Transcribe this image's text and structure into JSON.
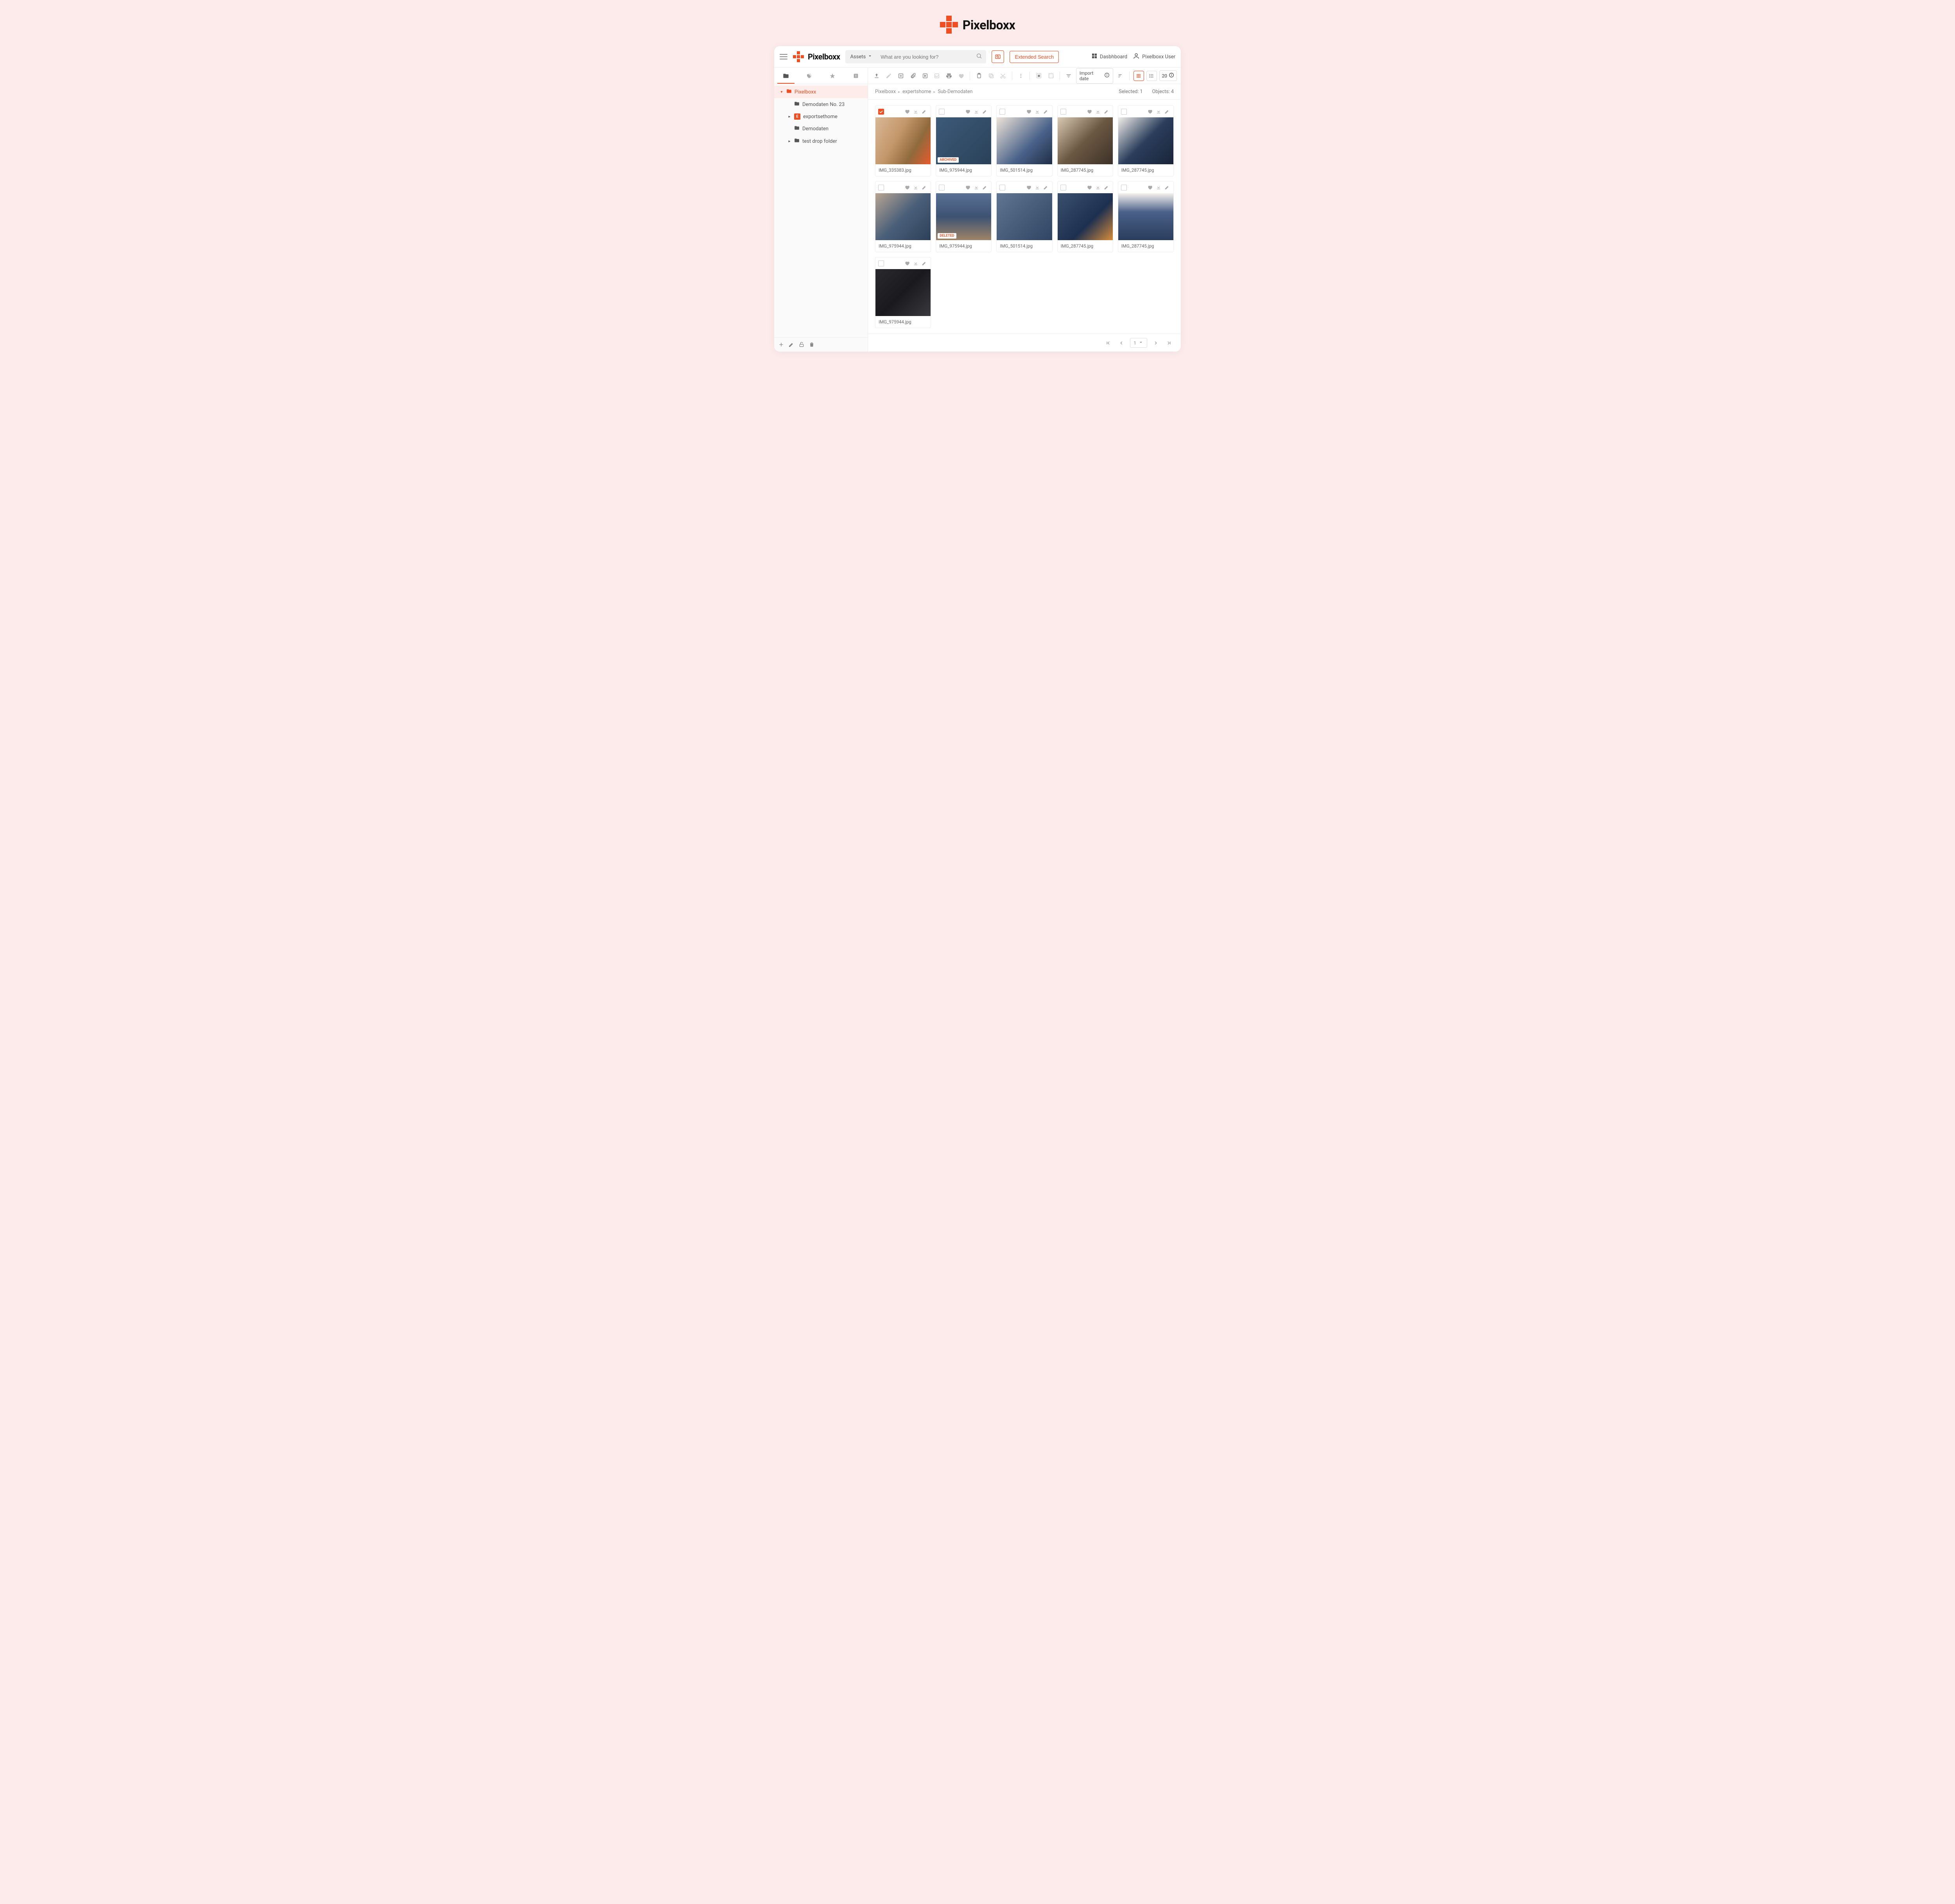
{
  "brand": {
    "name": "Pixelboxx"
  },
  "topbar": {
    "assets_label": "Assets",
    "search_placeholder": "What are you looking for?",
    "extended_search": "Extended Search",
    "dashboard": "Dasbhboard",
    "user": "Pixelboxx User"
  },
  "toolbar": {
    "import_date": "Import date",
    "page_size": "20"
  },
  "sidebar": {
    "items": [
      {
        "label": "Pixelboxx",
        "active": true,
        "expanded": true
      },
      {
        "label": "Demodaten No. 23"
      },
      {
        "label": "exportsethome",
        "caret": true,
        "iconE": true
      },
      {
        "label": "Demodaten"
      },
      {
        "label": "test drop folder",
        "caret": true
      }
    ]
  },
  "breadcrumb": {
    "items": [
      "Pixelboxx",
      "expertshome",
      "Sub-Demodaten"
    ],
    "selected_label": "Selected:",
    "selected_count": "1",
    "objects_label": "Objects:",
    "objects_count": "4"
  },
  "badges": {
    "archived": "ARCHIVED",
    "deleted": "DELETED"
  },
  "assets": [
    {
      "name": "IMG_335383.jpg",
      "checked": true,
      "thumb": "t1"
    },
    {
      "name": "IMG_975944.jpg",
      "badge": "archived",
      "thumb": "t2"
    },
    {
      "name": "IMG_501514.jpg",
      "thumb": "t3"
    },
    {
      "name": "IMG_287745.jpg",
      "thumb": "t4"
    },
    {
      "name": "IMG_287745.jpg",
      "thumb": "t5"
    },
    {
      "name": "IMG_975944.jpg",
      "thumb": "t6"
    },
    {
      "name": "IMG_975944.jpg",
      "badge": "deleted",
      "thumb": "t7"
    },
    {
      "name": "IMG_501514.jpg",
      "thumb": "t8"
    },
    {
      "name": "IMG_287745.jpg",
      "thumb": "t9"
    },
    {
      "name": "IMG_287745.jpg",
      "thumb": "t10"
    },
    {
      "name": "IMG_975944.jpg",
      "thumb": "t11"
    }
  ],
  "pager": {
    "page": "1"
  }
}
